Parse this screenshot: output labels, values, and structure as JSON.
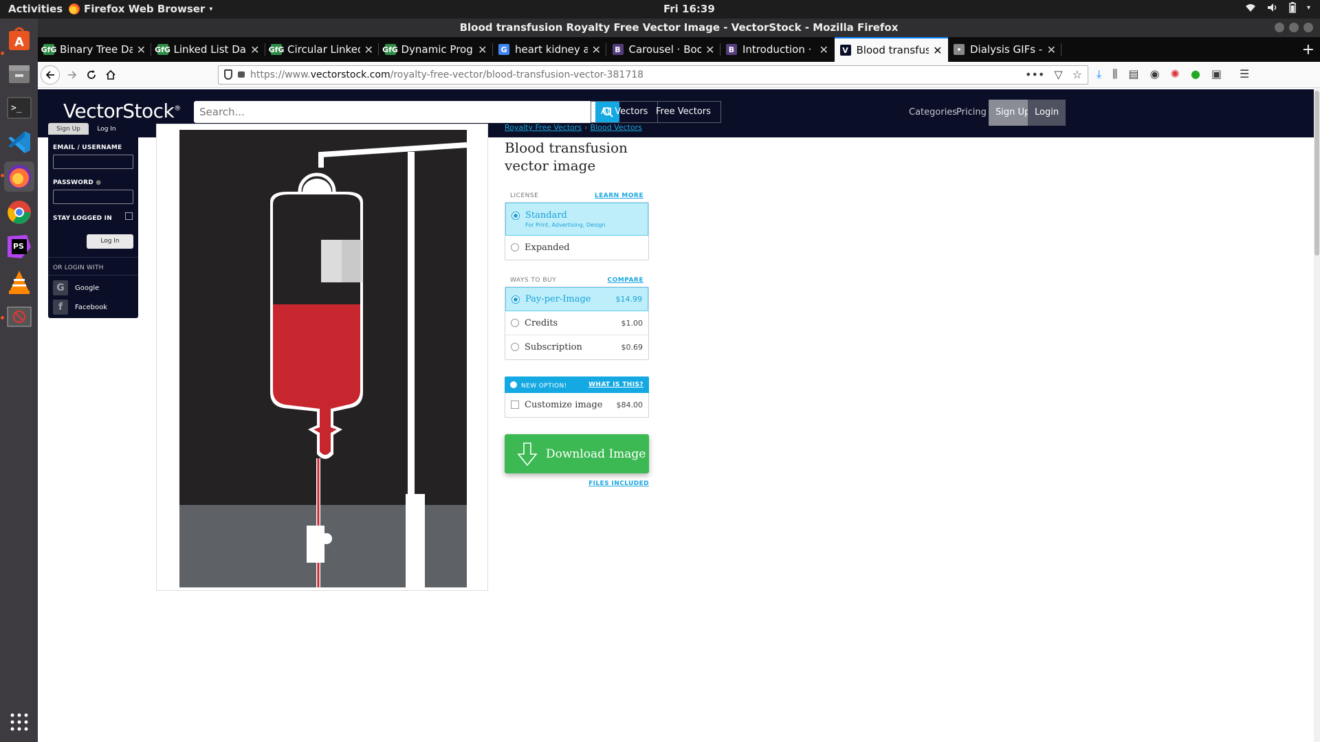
{
  "topbar": {
    "activities": "Activities",
    "app_name": "Firefox Web Browser",
    "clock": "Fri 16:39"
  },
  "dock": {
    "items": [
      "ubuntu-software",
      "files",
      "terminal",
      "vscode",
      "firefox",
      "chrome",
      "phpstorm",
      "vlc",
      "unknown-app"
    ]
  },
  "window": {
    "title": "Blood transfusion Royalty Free Vector Image - VectorStock - Mozilla Firefox"
  },
  "tabs": [
    {
      "title": "Binary Tree Data Stru",
      "icon": "GfG",
      "color": "#2f8d46"
    },
    {
      "title": "Linked List Data Struc",
      "icon": "GfG",
      "color": "#2f8d46"
    },
    {
      "title": "Circular Linked List | S",
      "icon": "GfG",
      "color": "#2f8d46"
    },
    {
      "title": "Dynamic Programmin",
      "icon": "GfG",
      "color": "#2f8d46"
    },
    {
      "title": "heart kidney animatio",
      "icon": "G",
      "color": "#4285f4"
    },
    {
      "title": "Carousel · Bootstrap",
      "icon": "B",
      "color": "#563d7c"
    },
    {
      "title": "Introduction · Bootstr",
      "icon": "B",
      "color": "#563d7c"
    },
    {
      "title": "Blood transfusion Ro",
      "icon": "V",
      "color": "#0a0e26"
    },
    {
      "title": "Dialysis GIFs - Find &",
      "icon": "•",
      "color": "#888888"
    }
  ],
  "nav": {
    "url_prefix": "https://www.",
    "url_domain": "vectorstock.com",
    "url_path": "/royalty-free-vector/blood-transfusion-vector-381718"
  },
  "site": {
    "logo": "VectorStock",
    "search_placeholder": "Search...",
    "all_vectors": "All Vectors",
    "free_vectors": "Free Vectors",
    "categories": "Categories",
    "pricing": "Pricing",
    "signup": "Sign Up",
    "login": "Login"
  },
  "login_widget": {
    "tab_signup": "Sign Up",
    "tab_login": "Log In",
    "email_label": "EMAIL / USERNAME",
    "password_label": "PASSWORD",
    "stay_logged_in": "STAY LOGGED IN",
    "login_button": "Log In",
    "or_login_with": "OR LOGIN WITH",
    "google": "Google",
    "facebook": "Facebook"
  },
  "product": {
    "crumb1": "Royalty Free Vectors",
    "crumb2": "Blood Vectors",
    "title_line1": "Blood transfusion",
    "title_line2": "vector image",
    "license_label": "LICENSE",
    "learn_more": "LEARN MORE",
    "license_standard": "Standard",
    "license_standard_sub": "For Print, Advertising, Design",
    "license_expanded": "Expanded",
    "ways_label": "WAYS TO BUY",
    "compare": "COMPARE",
    "ppi": "Pay-per-Image",
    "ppi_price": "$14.99",
    "credits": "Credits",
    "credits_price": "$1.00",
    "subscription": "Subscription",
    "subscription_price": "$0.69",
    "new_option": "NEW OPTION!",
    "what_is_this": "WHAT IS THIS?",
    "customize": "Customize image",
    "customize_price": "$84.00",
    "download": "Download Image",
    "files_included": "FILES INCLUDED"
  }
}
